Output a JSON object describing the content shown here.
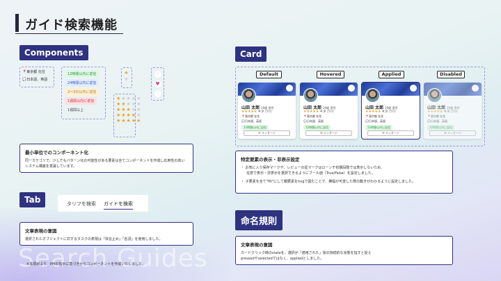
{
  "title": "ガイド検索機能",
  "watermark": "Search Guides",
  "components": {
    "label": "Components",
    "profile": {
      "location": "東京都 在住",
      "language": "日本語、英語"
    },
    "tags": [
      {
        "text": "12時間以内に返信",
        "color": "#1c9a3a",
        "bg": "#e3f6e6"
      },
      {
        "text": "24時間以内に返信",
        "color": "#2a5fc0",
        "bg": "#e3ecfa"
      },
      {
        "text": "2〜3日以内に返信",
        "color": "#c07a10",
        "bg": "#fbf0d8"
      },
      {
        "text": "1週間以内に返信",
        "color": "#d0303a",
        "bg": "#fbe1e2"
      },
      {
        "text": "1週間以上",
        "color": "#444",
        "bg": "transparent"
      }
    ],
    "note_title": "最小単位でのコンポーネント化",
    "note_text": "同一カテゴリで、少しでもパターン化の可能性がある要素は全てコンポーネントを作成し応用性の高いシステム構築を意識しています。"
  },
  "tab": {
    "label": "Tab",
    "tabs": [
      "タリフを検索",
      "ガイドを検索"
    ],
    "active": "ガイドを検索",
    "note_title": "文章表現の意図",
    "note_text": "選択されたオブジェクトに対するタスクの表現は「体言止め」「名詞」を使用しました。"
  },
  "footnote": "※本項目より、PMの指示に基づきからコンポーネントを作成いたしました。",
  "card": {
    "label": "Card",
    "states": [
      "Default",
      "Hovered",
      "Applied",
      "Disabled"
    ],
    "name": "山田 太郎",
    "age_gender": "29歳 男性",
    "rating": "4.9",
    "reviews": "(50)",
    "location": "東京都 在住",
    "language": "日本語、英語",
    "response": "12時間以内に返信",
    "message_button": "メッセージ",
    "note_title": "特定要素の表示・非表示設定",
    "note_lines": [
      "・ お気に入り保存マークや、レビューの星マークはローンチ初期段階では表示しないため、",
      "任意で表示・非表示を選択できるようにブール値（True/False）を設定しました。",
      "・ 子要素を全て\"fill\"にして親要素をhugで囲むことで、横幅が可変した際の動きがわかるように設定しました。"
    ]
  },
  "naming": {
    "label": "命名規則",
    "note_title": "文章表現の意図",
    "note_lines": [
      "カードクリック時のstateを、選択が「適用された」後の持続的な状態を指すと捉え",
      "pressedやselectedではなく、appliedとしました。"
    ]
  }
}
